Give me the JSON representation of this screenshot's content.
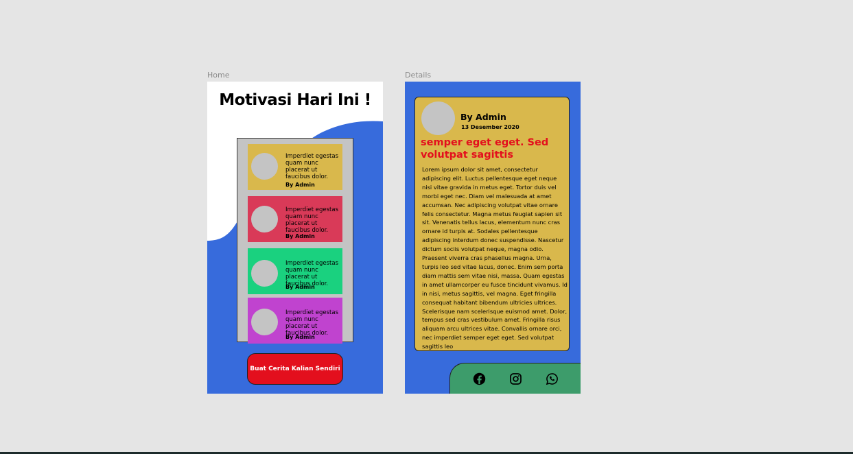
{
  "canvas": {
    "background": "#e5e5e5"
  },
  "home": {
    "frame_label": "Home",
    "title": "Motivasi Hari Ini !",
    "colors": {
      "blue": "#376bdc",
      "box": "#c4c4c4",
      "cta": "#e30f1d"
    },
    "cards": [
      {
        "text": "Imperdiet egestas quam nunc placerat ut faucibus dolor.",
        "author": "By Admin",
        "color": "#d9b84c"
      },
      {
        "text": "Imperdiet egestas quam nunc placerat ut faucibus dolor.",
        "author": "By Admin",
        "color": "#d93a58"
      },
      {
        "text": "Imperdiet egestas quam nunc placerat ut faucibus dolor.",
        "author": "By Admin",
        "color": "#1ad17f"
      },
      {
        "text": "Imperdiet egestas quam nunc placerat ut faucibus dolor.",
        "author": "By Admin",
        "color": "#c043cf"
      }
    ],
    "cta_label": "Buat Cerita Kalian Sendiri"
  },
  "details": {
    "frame_label": "Details",
    "colors": {
      "blue": "#376bdc",
      "card": "#d9b84c",
      "headline": "#e30f1d",
      "social_bar": "#3d9c6b"
    },
    "author": "By Admin",
    "date": "13 Desember 2020",
    "headline": "semper eget eget. Sed volutpat sagittis",
    "body": "Lorem ipsum dolor sit amet, consectetur adipiscing elit. Luctus pellentesque eget neque nisi vitae gravida in metus eget. Tortor duis vel morbi eget nec. Diam vel malesuada at amet accumsan. Nec adipiscing volutpat vitae ornare felis consectetur. Magna metus feugiat sapien sit sit. Venenatis tellus lacus, elementum nunc cras ornare id turpis at. Sodales pellentesque adipiscing interdum donec suspendisse. Nascetur dictum sociis volutpat neque, magna odio. Praesent viverra cras phasellus magna. Urna, turpis leo sed vitae lacus, donec. Enim sem porta diam mattis sem vitae nisi, massa. Quam egestas in amet ullamcorper eu fusce tincidunt vivamus. Id in nisi, metus sagittis, vel magna. Eget fringilla consequat habitant bibendum ultricies ultrices. Scelerisque nam scelerisque euismod amet. Dolor, tempus sed cras vestibulum amet. Fringilla risus aliquam arcu ultrices vitae. Convallis ornare orci, nec imperdiet semper eget eget. Sed volutpat sagittis leo",
    "social_icons": [
      "facebook-icon",
      "instagram-icon",
      "whatsapp-icon"
    ]
  }
}
